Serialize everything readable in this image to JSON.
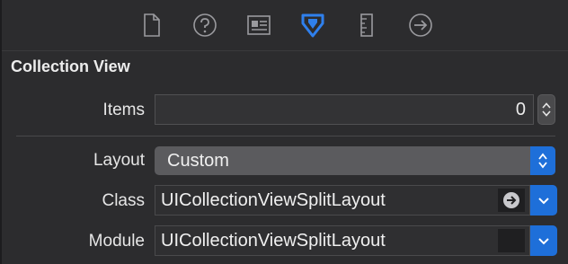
{
  "toolbar": {
    "tabs": [
      {
        "name": "file-inspector-icon",
        "active": false
      },
      {
        "name": "help-inspector-icon",
        "active": false
      },
      {
        "name": "identity-inspector-icon",
        "active": false
      },
      {
        "name": "attributes-inspector-icon",
        "active": true
      },
      {
        "name": "size-inspector-icon",
        "active": false
      },
      {
        "name": "connections-inspector-icon",
        "active": false
      }
    ],
    "active_color": "#2f80ed",
    "inactive_color": "#9a9a9e"
  },
  "section": {
    "title": "Collection View"
  },
  "items": {
    "label": "Items",
    "value": "0"
  },
  "layout": {
    "label": "Layout",
    "value": "Custom"
  },
  "class": {
    "label": "Class",
    "value": "UICollectionViewSplitLayout"
  },
  "module": {
    "label": "Module",
    "value": "UICollectionViewSplitLayout"
  }
}
